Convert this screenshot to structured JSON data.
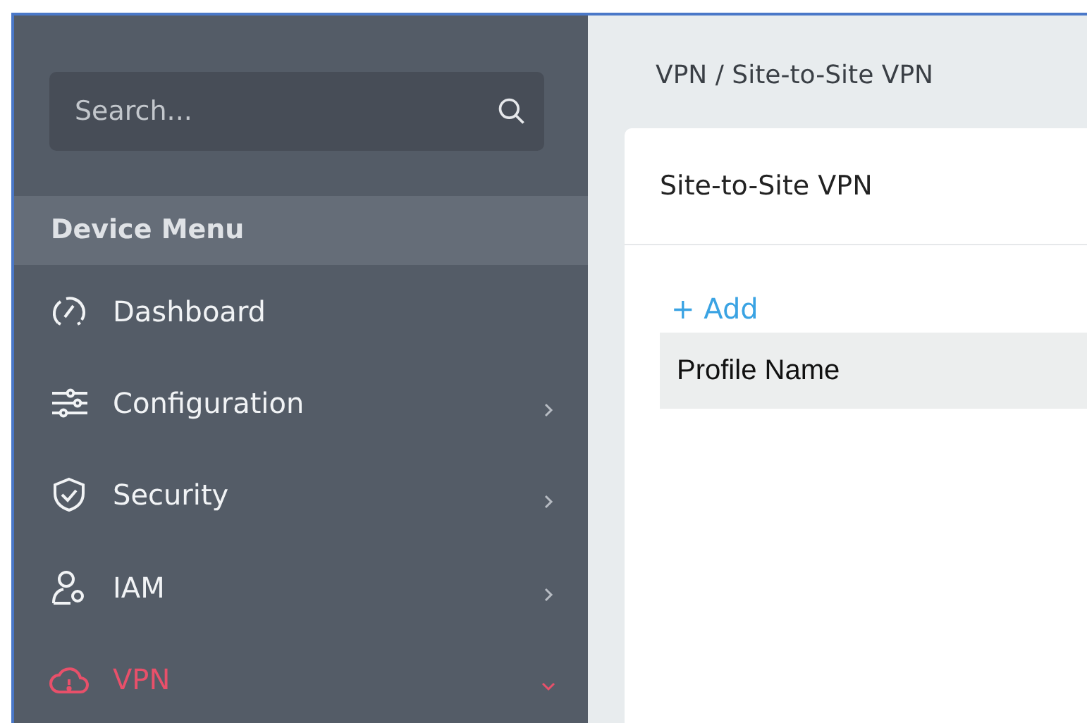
{
  "sidebar": {
    "search": {
      "placeholder": "Search..."
    },
    "section_title": "Device Menu",
    "items": [
      {
        "label": "Dashboard",
        "selected": false
      },
      {
        "label": "Configuration",
        "selected": false,
        "expanded": false
      },
      {
        "label": "Security",
        "selected": false,
        "expanded": false
      },
      {
        "label": "IAM",
        "selected": false,
        "expanded": false
      },
      {
        "label": "VPN",
        "selected": true,
        "expanded": true
      }
    ]
  },
  "breadcrumb": "VPN / Site-to-Site VPN",
  "card": {
    "title": "Site-to-Site VPN",
    "add_button": "+ Add",
    "table": {
      "columns": [
        "Profile Name"
      ]
    }
  }
}
